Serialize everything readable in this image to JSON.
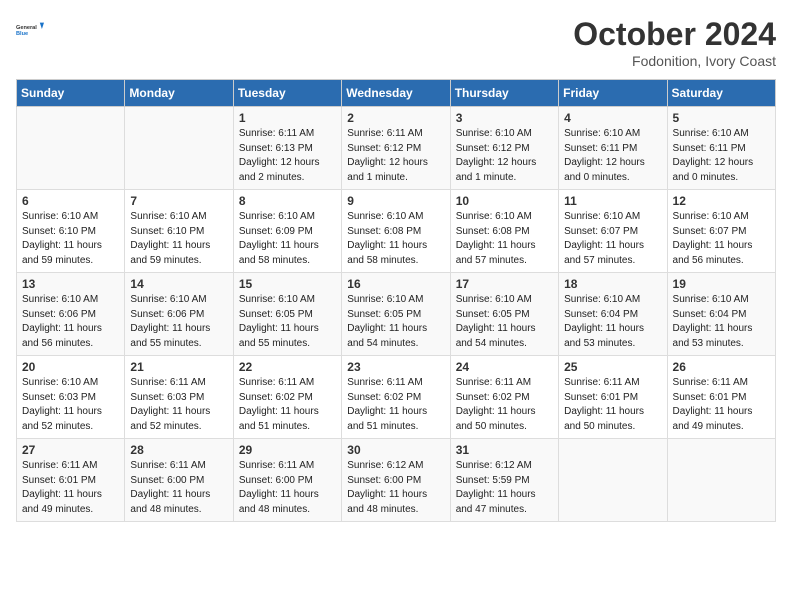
{
  "header": {
    "logo_line1": "General",
    "logo_line2": "Blue",
    "month": "October 2024",
    "location": "Fodonition, Ivory Coast"
  },
  "days_of_week": [
    "Sunday",
    "Monday",
    "Tuesday",
    "Wednesday",
    "Thursday",
    "Friday",
    "Saturday"
  ],
  "weeks": [
    [
      {
        "day": "",
        "info": ""
      },
      {
        "day": "",
        "info": ""
      },
      {
        "day": "1",
        "info": "Sunrise: 6:11 AM\nSunset: 6:13 PM\nDaylight: 12 hours\nand 2 minutes."
      },
      {
        "day": "2",
        "info": "Sunrise: 6:11 AM\nSunset: 6:12 PM\nDaylight: 12 hours\nand 1 minute."
      },
      {
        "day": "3",
        "info": "Sunrise: 6:10 AM\nSunset: 6:12 PM\nDaylight: 12 hours\nand 1 minute."
      },
      {
        "day": "4",
        "info": "Sunrise: 6:10 AM\nSunset: 6:11 PM\nDaylight: 12 hours\nand 0 minutes."
      },
      {
        "day": "5",
        "info": "Sunrise: 6:10 AM\nSunset: 6:11 PM\nDaylight: 12 hours\nand 0 minutes."
      }
    ],
    [
      {
        "day": "6",
        "info": "Sunrise: 6:10 AM\nSunset: 6:10 PM\nDaylight: 11 hours\nand 59 minutes."
      },
      {
        "day": "7",
        "info": "Sunrise: 6:10 AM\nSunset: 6:10 PM\nDaylight: 11 hours\nand 59 minutes."
      },
      {
        "day": "8",
        "info": "Sunrise: 6:10 AM\nSunset: 6:09 PM\nDaylight: 11 hours\nand 58 minutes."
      },
      {
        "day": "9",
        "info": "Sunrise: 6:10 AM\nSunset: 6:08 PM\nDaylight: 11 hours\nand 58 minutes."
      },
      {
        "day": "10",
        "info": "Sunrise: 6:10 AM\nSunset: 6:08 PM\nDaylight: 11 hours\nand 57 minutes."
      },
      {
        "day": "11",
        "info": "Sunrise: 6:10 AM\nSunset: 6:07 PM\nDaylight: 11 hours\nand 57 minutes."
      },
      {
        "day": "12",
        "info": "Sunrise: 6:10 AM\nSunset: 6:07 PM\nDaylight: 11 hours\nand 56 minutes."
      }
    ],
    [
      {
        "day": "13",
        "info": "Sunrise: 6:10 AM\nSunset: 6:06 PM\nDaylight: 11 hours\nand 56 minutes."
      },
      {
        "day": "14",
        "info": "Sunrise: 6:10 AM\nSunset: 6:06 PM\nDaylight: 11 hours\nand 55 minutes."
      },
      {
        "day": "15",
        "info": "Sunrise: 6:10 AM\nSunset: 6:05 PM\nDaylight: 11 hours\nand 55 minutes."
      },
      {
        "day": "16",
        "info": "Sunrise: 6:10 AM\nSunset: 6:05 PM\nDaylight: 11 hours\nand 54 minutes."
      },
      {
        "day": "17",
        "info": "Sunrise: 6:10 AM\nSunset: 6:05 PM\nDaylight: 11 hours\nand 54 minutes."
      },
      {
        "day": "18",
        "info": "Sunrise: 6:10 AM\nSunset: 6:04 PM\nDaylight: 11 hours\nand 53 minutes."
      },
      {
        "day": "19",
        "info": "Sunrise: 6:10 AM\nSunset: 6:04 PM\nDaylight: 11 hours\nand 53 minutes."
      }
    ],
    [
      {
        "day": "20",
        "info": "Sunrise: 6:10 AM\nSunset: 6:03 PM\nDaylight: 11 hours\nand 52 minutes."
      },
      {
        "day": "21",
        "info": "Sunrise: 6:11 AM\nSunset: 6:03 PM\nDaylight: 11 hours\nand 52 minutes."
      },
      {
        "day": "22",
        "info": "Sunrise: 6:11 AM\nSunset: 6:02 PM\nDaylight: 11 hours\nand 51 minutes."
      },
      {
        "day": "23",
        "info": "Sunrise: 6:11 AM\nSunset: 6:02 PM\nDaylight: 11 hours\nand 51 minutes."
      },
      {
        "day": "24",
        "info": "Sunrise: 6:11 AM\nSunset: 6:02 PM\nDaylight: 11 hours\nand 50 minutes."
      },
      {
        "day": "25",
        "info": "Sunrise: 6:11 AM\nSunset: 6:01 PM\nDaylight: 11 hours\nand 50 minutes."
      },
      {
        "day": "26",
        "info": "Sunrise: 6:11 AM\nSunset: 6:01 PM\nDaylight: 11 hours\nand 49 minutes."
      }
    ],
    [
      {
        "day": "27",
        "info": "Sunrise: 6:11 AM\nSunset: 6:01 PM\nDaylight: 11 hours\nand 49 minutes."
      },
      {
        "day": "28",
        "info": "Sunrise: 6:11 AM\nSunset: 6:00 PM\nDaylight: 11 hours\nand 48 minutes."
      },
      {
        "day": "29",
        "info": "Sunrise: 6:11 AM\nSunset: 6:00 PM\nDaylight: 11 hours\nand 48 minutes."
      },
      {
        "day": "30",
        "info": "Sunrise: 6:12 AM\nSunset: 6:00 PM\nDaylight: 11 hours\nand 48 minutes."
      },
      {
        "day": "31",
        "info": "Sunrise: 6:12 AM\nSunset: 5:59 PM\nDaylight: 11 hours\nand 47 minutes."
      },
      {
        "day": "",
        "info": ""
      },
      {
        "day": "",
        "info": ""
      }
    ]
  ]
}
